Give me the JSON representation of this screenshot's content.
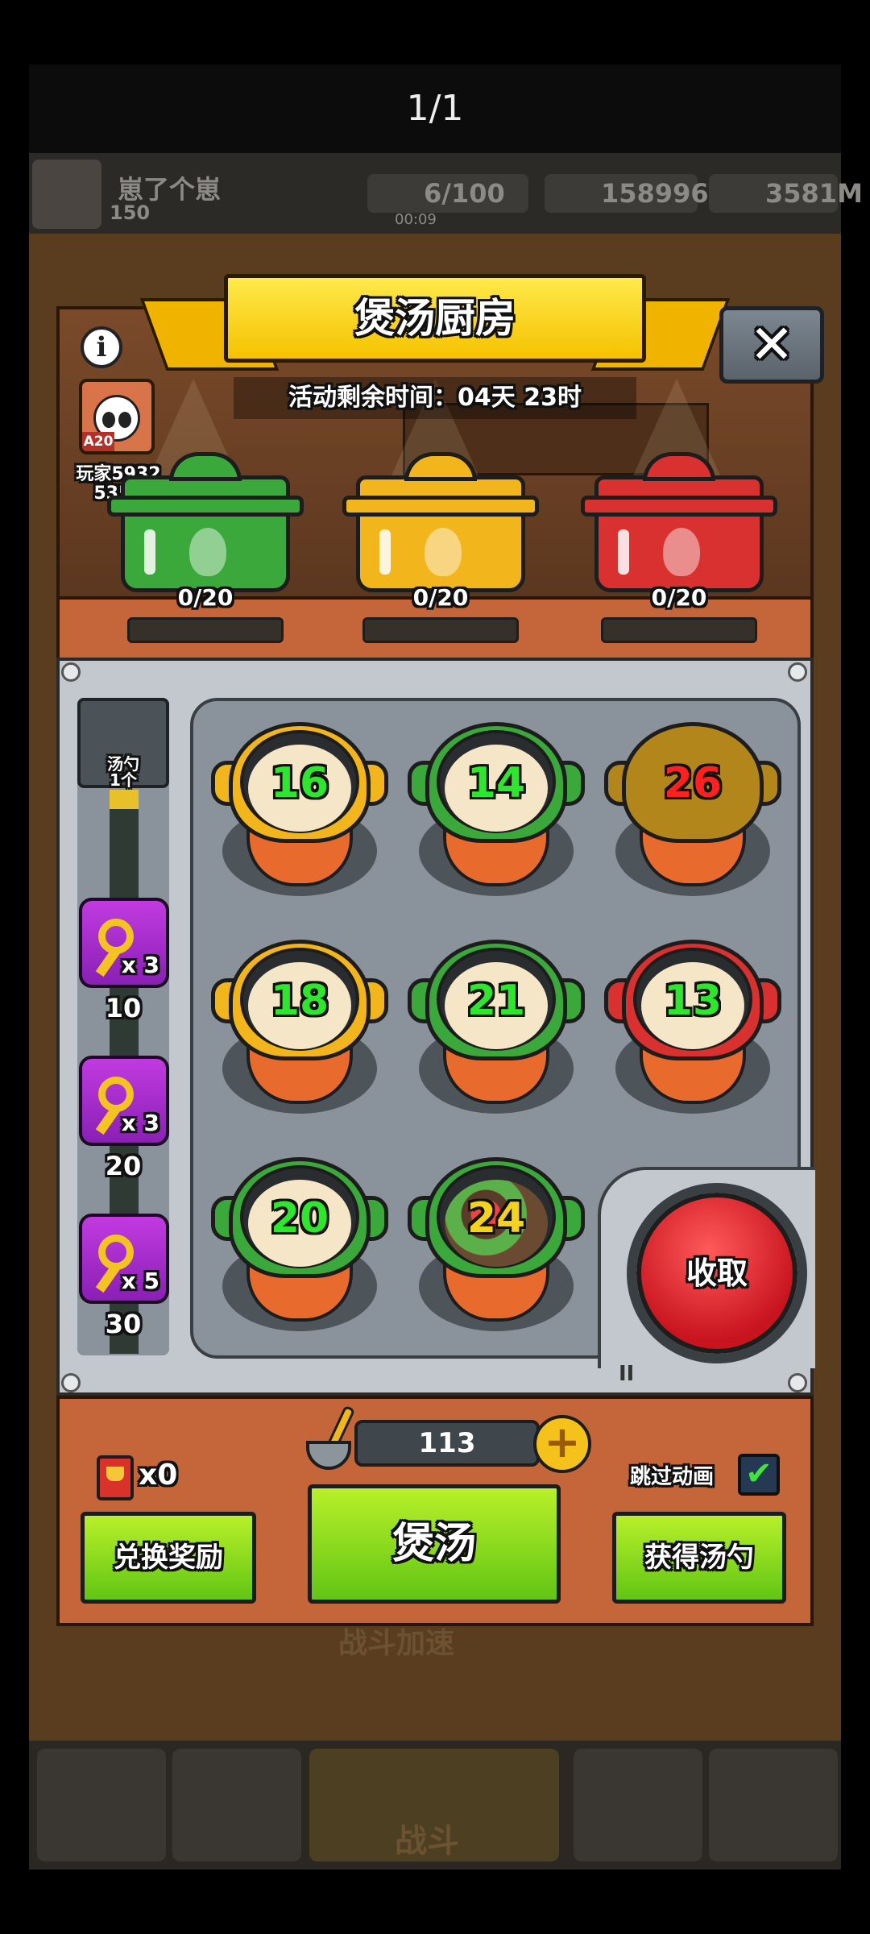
{
  "page_indicator": "1/1",
  "background_hud": {
    "player_name": "崽了个崽",
    "level": "150",
    "energy": "6/100",
    "energy_timer": "00:09",
    "gems": "158996",
    "coins": "3581M",
    "speedup_label": "战斗加速",
    "battle_label": "战斗"
  },
  "modal": {
    "title": "煲汤厨房",
    "close_label": "✕",
    "info_label": "i",
    "timer": "活动剩余时间：04天 23时",
    "player": {
      "name": "玩家5932",
      "id": "5351",
      "level_badge": "A20"
    },
    "big_pots": [
      {
        "color": "green",
        "count": "0/20"
      },
      {
        "color": "yellow",
        "count": "0/20"
      },
      {
        "color": "red",
        "count": "0/20"
      }
    ],
    "ladle_track": {
      "label": "汤勺\n1个",
      "rewards": [
        {
          "qty": "x 3",
          "requirement": "10"
        },
        {
          "qty": "x 3",
          "requirement": "20"
        },
        {
          "qty": "x 5",
          "requirement": "30"
        }
      ]
    },
    "pots": [
      {
        "color": "yellow",
        "number": "16",
        "number_color": "#2ee62e"
      },
      {
        "color": "green",
        "number": "14",
        "number_color": "#2ee62e"
      },
      {
        "color": "gold",
        "number": "26",
        "number_color": "#ff2020"
      },
      {
        "color": "yellow",
        "number": "18",
        "number_color": "#2ee62e"
      },
      {
        "color": "green",
        "number": "21",
        "number_color": "#2ee62e"
      },
      {
        "color": "red",
        "number": "13",
        "number_color": "#2ee62e"
      },
      {
        "color": "green",
        "number": "20",
        "number_color": "#2ee62e"
      },
      {
        "color": "green",
        "number": "24",
        "number_color": "#f5d31b",
        "filled": true
      }
    ],
    "collect_label": "收取",
    "pause_label": "II",
    "bottom": {
      "book_count": "x0",
      "ladle_count": "113",
      "plus_label": "+",
      "skip_label": "跳过动画",
      "skip_checked": "✔",
      "redeem_label": "兑换奖励",
      "cook_label": "煲汤",
      "get_ladle_label": "获得汤勺"
    }
  }
}
